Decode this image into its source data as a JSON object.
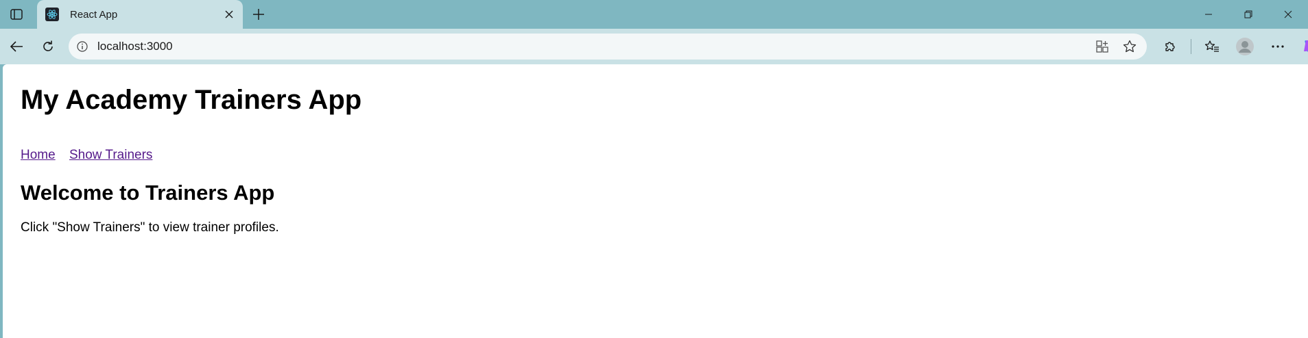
{
  "browser": {
    "tab": {
      "title": "React App"
    },
    "address_bar": {
      "url": "localhost:3000"
    }
  },
  "page": {
    "title": "My Academy Trainers App",
    "nav": [
      {
        "label": "Home"
      },
      {
        "label": "Show Trainers"
      }
    ],
    "welcome_heading": "Welcome to Trainers App",
    "intro_text": "Click \"Show Trainers\" to view trainer profiles."
  },
  "colors": {
    "frame": "#7fb7c1",
    "toolbar": "#c9e1e5",
    "link_visited": "#551a8b"
  },
  "icons": {
    "tab_actions": "tab-actions-icon",
    "favicon": "react-logo-icon",
    "close": "close-icon",
    "new_tab": "plus-icon",
    "back": "back-arrow-icon",
    "reload": "reload-icon",
    "info": "info-icon",
    "app_available": "app-available-icon",
    "favorite": "star-icon",
    "extensions": "puzzle-icon",
    "favorites": "favorites-list-icon",
    "profile": "profile-avatar-icon",
    "menu": "more-dots-icon",
    "copilot": "copilot-icon"
  }
}
